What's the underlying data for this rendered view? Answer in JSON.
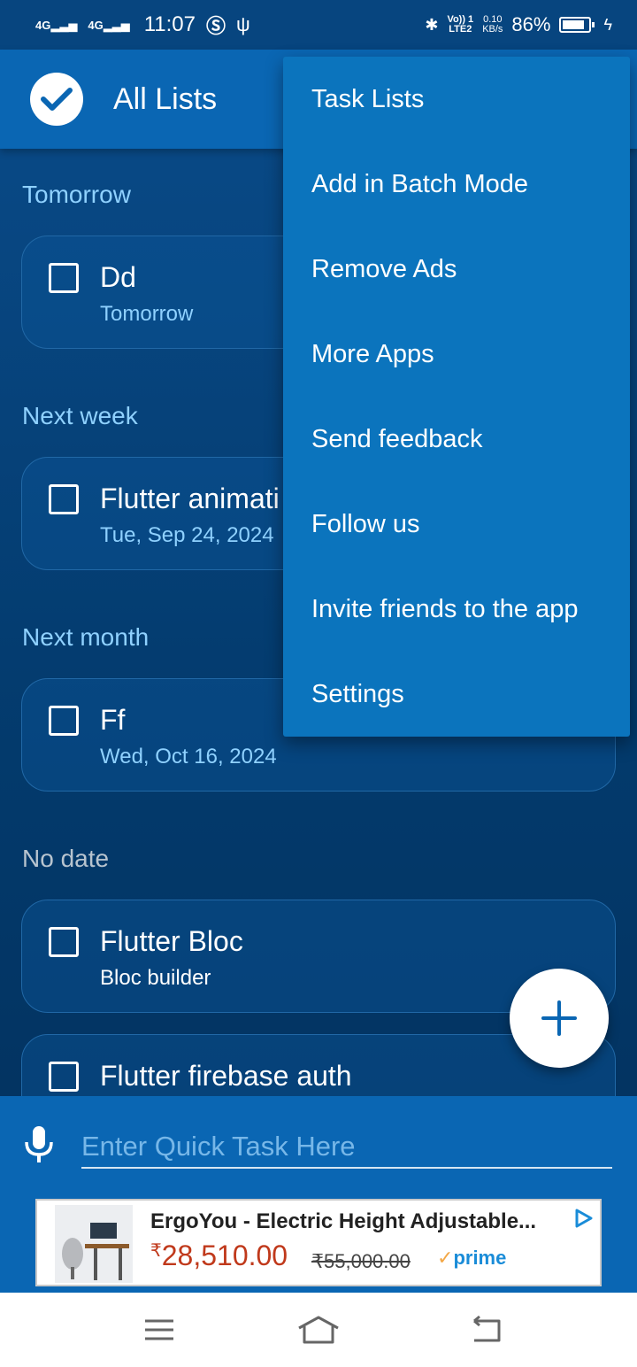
{
  "status_bar": {
    "signal1": "4G",
    "signal2": "4G",
    "time": "11:07",
    "volte": "Vo)) 1\nLTE2",
    "speed_value": "0.10",
    "speed_unit": "KB/s",
    "battery": "86%"
  },
  "app_bar": {
    "title": "All Lists"
  },
  "sections": [
    {
      "label": "Tomorrow",
      "task": {
        "title": "Dd",
        "subtitle": "Tomorrow"
      }
    },
    {
      "label": "Next week",
      "task": {
        "title": "Flutter animati",
        "subtitle": "Tue, Sep 24, 2024"
      }
    },
    {
      "label": "Next month",
      "task": {
        "title": "Ff",
        "subtitle": "Wed, Oct 16, 2024"
      }
    },
    {
      "label": "No date",
      "tasks": [
        {
          "title": "Flutter Bloc",
          "subtitle": "Bloc builder"
        },
        {
          "title": "Flutter firebase auth",
          "subtitle": ""
        }
      ]
    }
  ],
  "overflow_menu": {
    "items": [
      "Task Lists",
      "Add in Batch Mode",
      "Remove Ads",
      "More Apps",
      "Send feedback",
      "Follow us",
      "Invite friends to the app",
      "Settings"
    ]
  },
  "quick_task": {
    "placeholder": "Enter Quick Task Here"
  },
  "ad": {
    "title": "ErgoYou - Electric Height Adjustable...",
    "currency": "₹",
    "price": "28,510.00",
    "old_price": "₹55,000.00",
    "badge": "prime"
  },
  "colors": {
    "app_bar": "#0a66b3",
    "menu": "#0b74bd",
    "section_header": "#8fd1ff",
    "background": "#033a6c"
  }
}
